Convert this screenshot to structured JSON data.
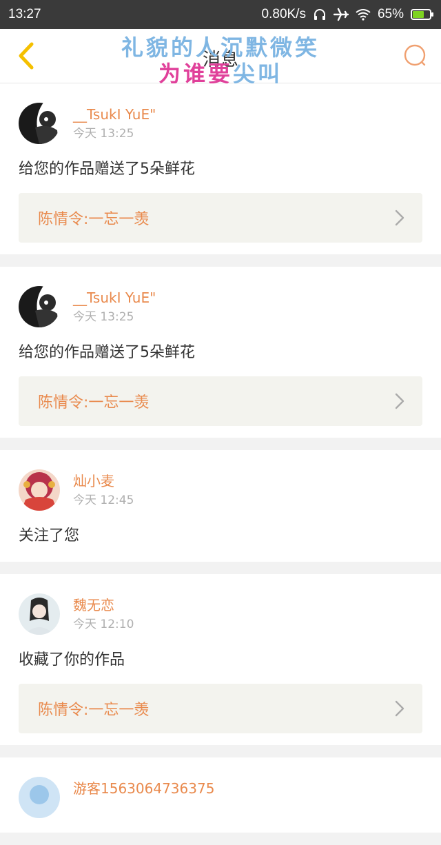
{
  "statusbar": {
    "time": "13:27",
    "speed": "0.80K/s",
    "battery": "65%"
  },
  "header": {
    "title": "消息",
    "overlay_line1": "礼貌的人沉默微笑",
    "overlay_line2_pink": "为谁要",
    "overlay_line2_blue": "尖叫"
  },
  "messages": [
    {
      "user": "__TsukI YuE\"",
      "time": "今天 13:25",
      "action": "给您的作品赠送了5朵鲜花",
      "work": "陈情令:一忘一羡"
    },
    {
      "user": "__TsukI YuE\"",
      "time": "今天 13:25",
      "action": "给您的作品赠送了5朵鲜花",
      "work": "陈情令:一忘一羡"
    },
    {
      "user": "灿小麦",
      "time": "今天 12:45",
      "action": "关注了您"
    },
    {
      "user": "魏无恋",
      "time": "今天 12:10",
      "action": "收藏了你的作品",
      "work": "陈情令:一忘一羡"
    },
    {
      "user": "游客1563064736375"
    }
  ],
  "colors": {
    "accent": "#e98a4d",
    "statusbar": "#3a3a3a",
    "back_icon": "#f5c000"
  }
}
